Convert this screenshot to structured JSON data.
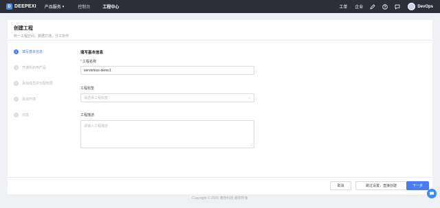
{
  "topbar": {
    "logo_text": "DEEPEXI",
    "logo_mark": "D",
    "products_label": "产品服务",
    "nav": [
      "控制台",
      "工程中心"
    ],
    "right_links": [
      "工单",
      "企业"
    ],
    "icons": [
      "edit-icon",
      "help-icon",
      "message-icon"
    ],
    "username": "DevOps"
  },
  "header": {
    "title": "创建工程",
    "subtitle": "统一工程空间，数据打通，分工协作"
  },
  "steps": [
    {
      "num": "1",
      "label": "填写基本信息"
    },
    {
      "num": "2",
      "label": "开通所启用产品"
    },
    {
      "num": "3",
      "label": "添加成员并分配权限"
    },
    {
      "num": "4",
      "label": "添加环境"
    },
    {
      "num": "5",
      "label": "完成"
    }
  ],
  "form": {
    "section_title": "填写基本信息",
    "name_label": "工程名称",
    "name_value": "serverless-demo1",
    "tags_label": "工程标签",
    "tags_placeholder": "请选择工程标签",
    "desc_label": "工程描述",
    "desc_placeholder": "请输入工程描述"
  },
  "buttons": {
    "cancel": "取消",
    "skip": "跳过设置，直接创建",
    "next": "下一步"
  },
  "copyright": "Copyright © 2020 滴普科技 版权所有",
  "colors": {
    "primary": "#4a7bf6",
    "topbar_bg": "#2d2f38",
    "page_bg": "#eef0f4"
  }
}
